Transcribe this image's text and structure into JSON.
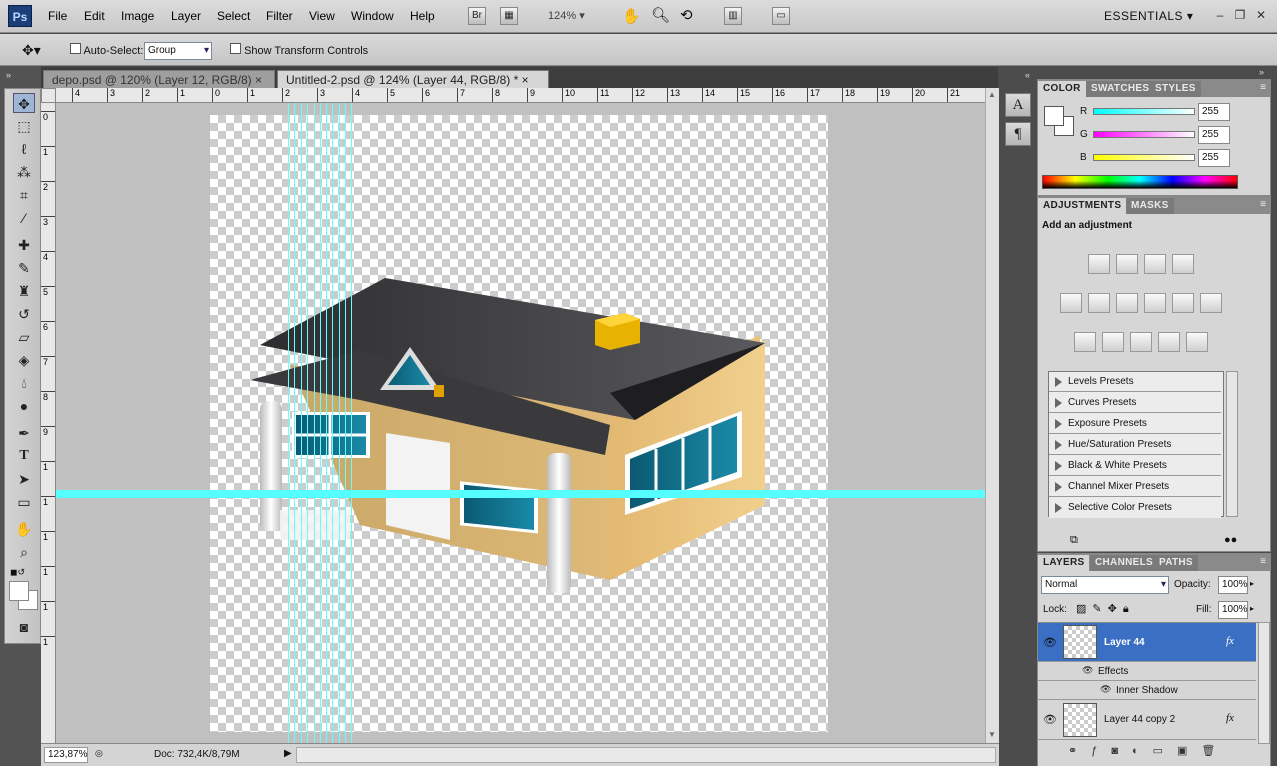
{
  "app": {
    "logo": "Ps",
    "workspace": "ESSENTIALS",
    "zoom": "124%",
    "bridge_label": "Br"
  },
  "menu": [
    "File",
    "Edit",
    "Image",
    "Layer",
    "Select",
    "Filter",
    "View",
    "Window",
    "Help"
  ],
  "options": {
    "auto_select_label": "Auto-Select:",
    "auto_select_value": "Group",
    "transform_label": "Show Transform Controls"
  },
  "tabs": [
    {
      "label": "depo.psd @ 120% (Layer 12, RGB/8)",
      "close": "×"
    },
    {
      "label": "Untitled-2.psd @ 124% (Layer 44, RGB/8) *",
      "close": "×"
    }
  ],
  "ruler_h": [
    "4",
    "3",
    "2",
    "1",
    "0",
    "1",
    "2",
    "3",
    "4",
    "5",
    "6",
    "7",
    "8",
    "9",
    "10",
    "11",
    "12",
    "13",
    "14",
    "15",
    "16",
    "17",
    "18",
    "19",
    "20",
    "21"
  ],
  "ruler_v": [
    "0",
    "1",
    "2",
    "3",
    "4",
    "5",
    "6",
    "7",
    "8",
    "9",
    "1",
    "1",
    "1",
    "1",
    "1",
    "1"
  ],
  "status": {
    "zoom": "123,87%",
    "doc": "Doc: 732,4K/8,79M"
  },
  "color_panel": {
    "tabs": [
      "COLOR",
      "SWATCHES",
      "STYLES"
    ],
    "r_label": "R",
    "g_label": "G",
    "b_label": "B",
    "r": "255",
    "g": "255",
    "b": "255"
  },
  "adjustments_panel": {
    "tabs": [
      "ADJUSTMENTS",
      "MASKS"
    ],
    "heading": "Add an adjustment",
    "presets": [
      "Levels Presets",
      "Curves Presets",
      "Exposure Presets",
      "Hue/Saturation Presets",
      "Black & White Presets",
      "Channel Mixer Presets",
      "Selective Color Presets"
    ]
  },
  "layers_panel": {
    "tabs": [
      "LAYERS",
      "CHANNELS",
      "PATHS"
    ],
    "blend_mode": "Normal",
    "opacity_label": "Opacity:",
    "opacity": "100%",
    "lock_label": "Lock:",
    "fill_label": "Fill:",
    "fill": "100%",
    "layers": [
      {
        "name": "Layer 44",
        "fx": "fx",
        "selected": true
      },
      {
        "name": "Layer 44 copy 2",
        "fx": "fx",
        "selected": false
      }
    ],
    "effects_label": "Effects",
    "inner_shadow_label": "Inner Shadow"
  },
  "colors": {
    "accent_selected": "#3a6fc4",
    "guide": "#66ffff"
  }
}
